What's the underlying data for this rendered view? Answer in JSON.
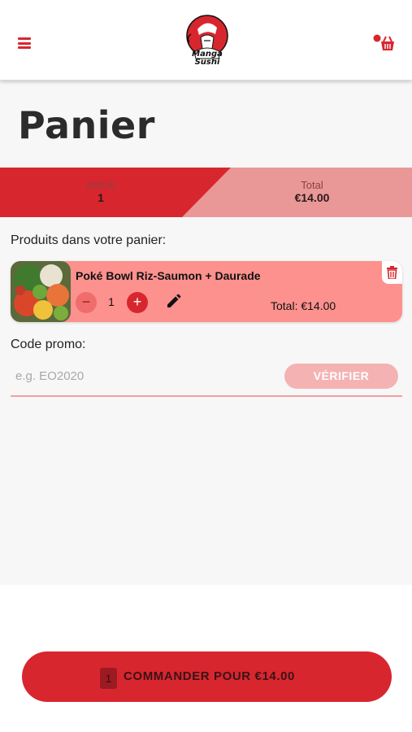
{
  "brand": {
    "logo_text_line1": "Manga",
    "logo_text_line2": "Sushi"
  },
  "header": {
    "menu_icon": "hamburger-icon",
    "cart_icon": "shopping-basket-icon"
  },
  "page": {
    "title": "Panier"
  },
  "summary": {
    "article_label": "Article",
    "article_value": "1",
    "total_label": "Total",
    "total_value": "€14.00"
  },
  "cart": {
    "section_label": "Produits dans votre panier:",
    "items": [
      {
        "name": "Poké Bowl Riz-Saumon + Daurade",
        "quantity": "1",
        "minus_label": "−",
        "plus_label": "+",
        "total": "Total: €14.00"
      }
    ]
  },
  "promo": {
    "label": "Code promo:",
    "placeholder": "e.g. EO2020",
    "value": "",
    "verify_label": "VÉRIFIER"
  },
  "order": {
    "count": "1",
    "label": "COMMANDER POUR €14.00"
  },
  "colors": {
    "primary": "#d8262f",
    "summary_right": "#e99897",
    "card_bg": "#fd918e",
    "verify_disabled": "#f4b3b2"
  }
}
